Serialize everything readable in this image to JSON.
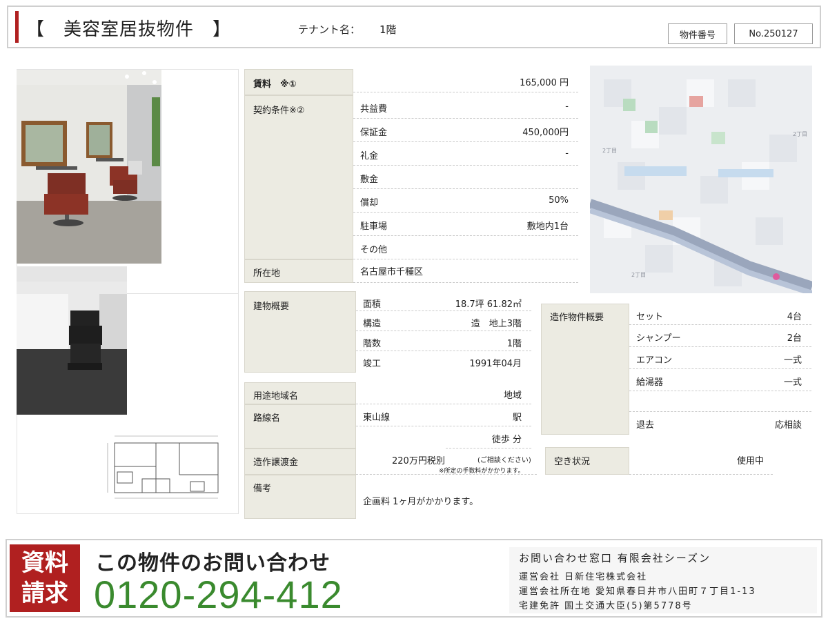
{
  "header": {
    "title": "【　美容室居抜物件　】",
    "tenant_label": "テナント名：",
    "tenant_value": "1階",
    "property_number_label": "物件番号",
    "property_number_value": "No.250127"
  },
  "rent": {
    "label": "賃料　※①",
    "value": "165,000 円"
  },
  "contract": {
    "label": "契約条件※②",
    "items": [
      {
        "label": "共益費",
        "value": "-"
      },
      {
        "label": "保証金",
        "value": "450,000円"
      },
      {
        "label": "礼金",
        "value": "-"
      },
      {
        "label": "敷金",
        "value": ""
      },
      {
        "label": "償却",
        "value": "50%"
      },
      {
        "label": "駐車場",
        "value": "敷地内1台"
      },
      {
        "label": "その他",
        "value": ""
      }
    ]
  },
  "location": {
    "label": "所在地",
    "value": "名古屋市千種区"
  },
  "building": {
    "label": "建物概要",
    "items": [
      {
        "label": "面積",
        "value": "18.7坪 61.82㎡"
      },
      {
        "label": "構造",
        "value": "造　地上3階"
      },
      {
        "label": "階数",
        "value": "1階"
      },
      {
        "label": "竣工",
        "value": "1991年04月"
      }
    ]
  },
  "zoning": {
    "label": "用途地域名",
    "value": "地域"
  },
  "route": {
    "label": "路線名",
    "line": "東山線",
    "station": "駅",
    "walk": "徒歩 分"
  },
  "transfer": {
    "label": "造作譲渡金",
    "value": "220万円税別",
    "consult": "(ご相談ください)",
    "note": "※所定の手数料がかかります。"
  },
  "remarks": {
    "label": "備考",
    "value": "企画料 1ヶ月がかかります。"
  },
  "fixtures": {
    "label": "造作物件概要",
    "items": [
      {
        "label": "セット",
        "value": "4台"
      },
      {
        "label": "シャンプー",
        "value": "2台"
      },
      {
        "label": "エアコン",
        "value": "一式"
      },
      {
        "label": "給湯器",
        "value": "一式"
      },
      {
        "label": "",
        "value": ""
      },
      {
        "label": "退去",
        "value": "応相談"
      }
    ]
  },
  "vacancy": {
    "label": "空き状況",
    "value": "使用中"
  },
  "footer": {
    "request_line1": "資料",
    "request_line2": "請求",
    "heading": "この物件のお問い合わせ",
    "phone": "0120-294-412",
    "company_lines": [
      "お問い合わせ窓口 有限会社シーズン",
      "運営会社 日新住宅株式会社",
      "運営会社所在地 愛知県春日井市八田町７丁目1-13",
      "宅建免許 国土交通大臣(5)第5778号"
    ]
  },
  "colors": {
    "accent_red": "#b02020",
    "phone_green": "#3a8a2e",
    "label_bg": "#ecebe2"
  }
}
